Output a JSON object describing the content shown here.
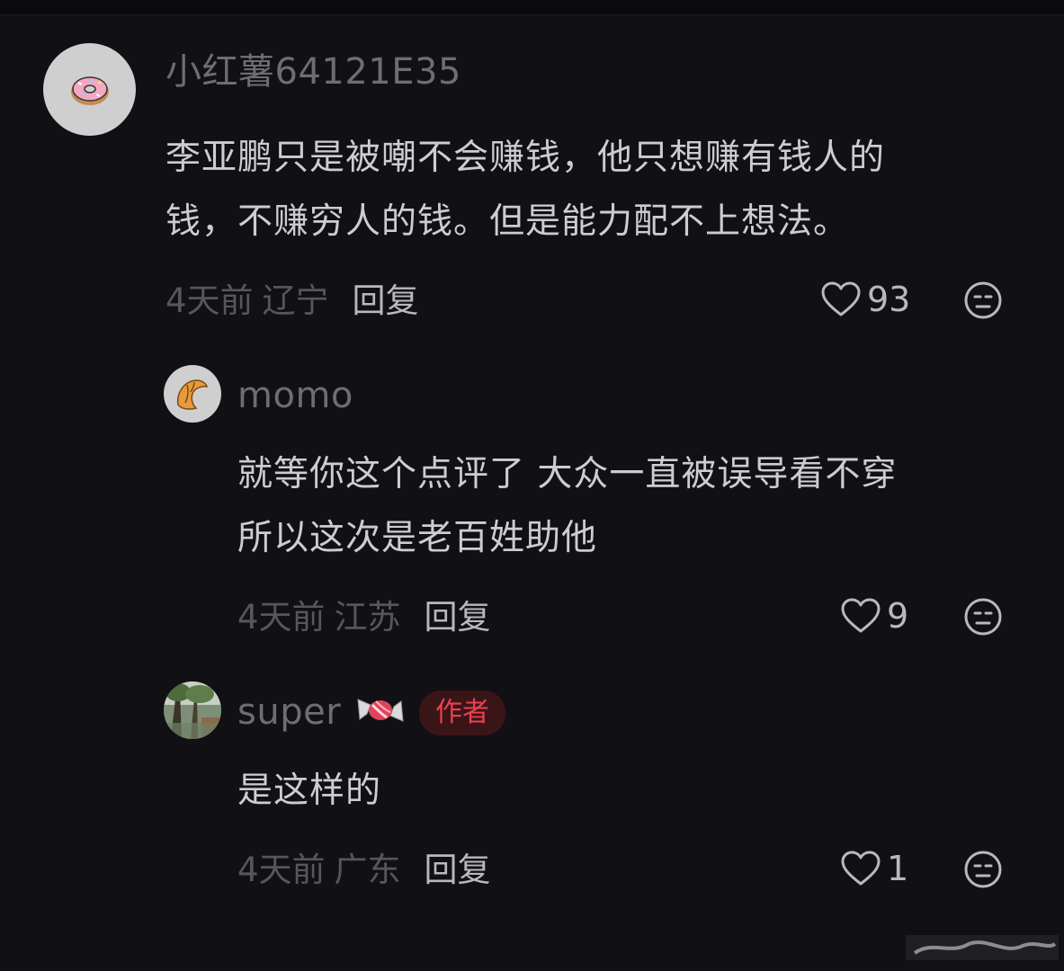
{
  "comments": [
    {
      "username": "小红薯64121E35",
      "avatar_icon": "donut-icon",
      "text_lines": [
        "李亚鹏只是被嘲不会赚钱，他只想赚有钱人的",
        "钱，不赚穷人的钱。但是能力配不上想法。"
      ],
      "time": "4天前",
      "location": "辽宁",
      "reply_label": "回复",
      "likes": "93"
    },
    {
      "username": "momo",
      "avatar_icon": "croissant-icon",
      "text_lines": [
        "就等你这个点评了 大众一直被误导看不穿",
        "所以这次是老百姓助他"
      ],
      "time": "4天前",
      "location": "江苏",
      "reply_label": "回复",
      "likes": "9"
    },
    {
      "username": "super",
      "avatar_icon": "scenery-photo-icon",
      "name_emoji": "candy-icon",
      "badge": "作者",
      "text_lines": [
        "是这样的"
      ],
      "time": "4天前",
      "location": "广东",
      "reply_label": "回复",
      "likes": "1"
    }
  ],
  "colors": {
    "background": "#111014",
    "username": "#6e6d73",
    "text": "#cdccd1",
    "meta": "#57565c",
    "reply": "#b9b8bd",
    "badge_bg": "#3a1518",
    "badge_text": "#e8424e"
  }
}
